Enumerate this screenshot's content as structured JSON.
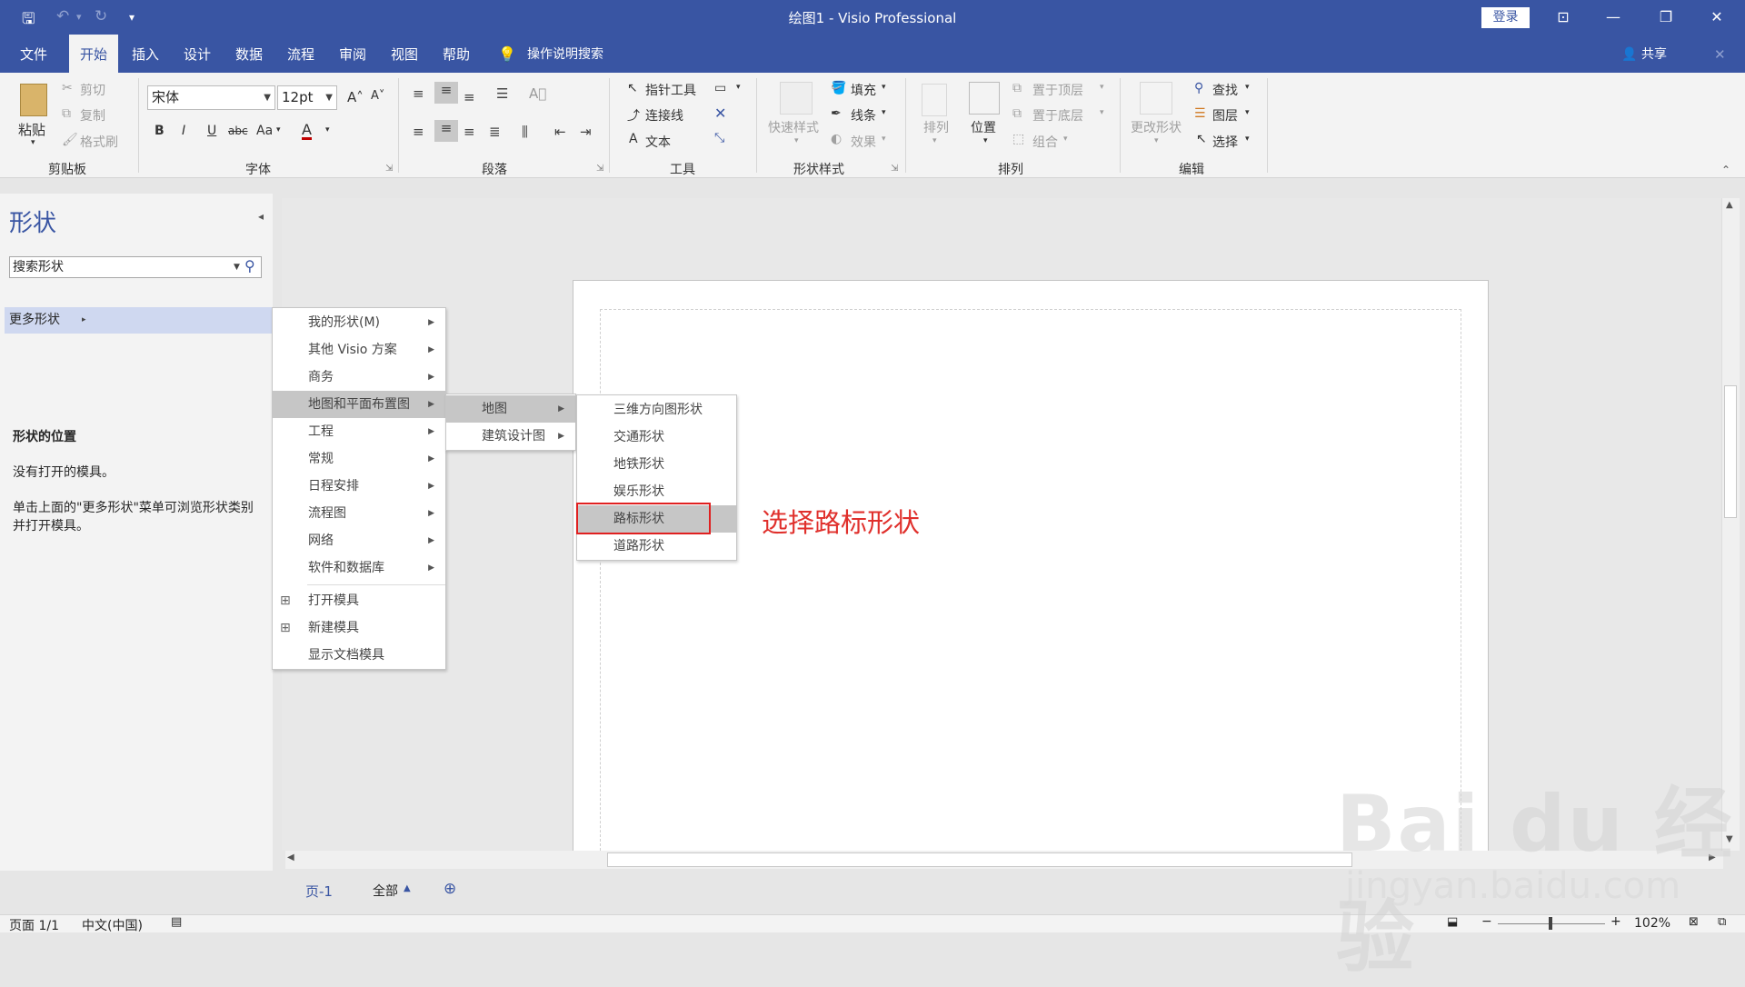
{
  "titlebar": {
    "title": "绘图1  -  Visio Professional",
    "login": "登录",
    "icons": [
      "save-icon",
      "undo-icon",
      "redo-icon",
      "customize-icon",
      "ribbon-display-icon",
      "minimize-icon",
      "restore-icon",
      "close-icon"
    ]
  },
  "tabs": {
    "items": [
      "文件",
      "开始",
      "插入",
      "设计",
      "数据",
      "流程",
      "审阅",
      "视图",
      "帮助"
    ],
    "active": "开始",
    "tell_me": "操作说明搜索",
    "share": "共享"
  },
  "ribbon": {
    "clipboard": {
      "label": "剪贴板",
      "paste": "粘贴",
      "cut": "剪切",
      "copy": "复制",
      "format_painter": "格式刷"
    },
    "font": {
      "label": "字体",
      "font_name": "宋体",
      "font_size": "12pt",
      "bold": "B",
      "italic": "I",
      "underline": "U",
      "strike": "abc",
      "case": "Aa",
      "color": "A"
    },
    "paragraph": {
      "label": "段落"
    },
    "tools": {
      "label": "工具",
      "pointer": "指针工具",
      "connector": "连接线",
      "text": "文本"
    },
    "shape_styles": {
      "label": "形状样式",
      "quick_styles": "快速样式",
      "fill": "填充",
      "line": "线条",
      "effects": "效果"
    },
    "arrange": {
      "label": "排列",
      "arrange_btn": "排列",
      "position": "位置",
      "bring_front": "置于顶层",
      "send_back": "置于底层",
      "group": "组合"
    },
    "editing": {
      "label": "编辑",
      "change_shape": "更改形状",
      "find": "查找",
      "layers": "图层",
      "select": "选择"
    }
  },
  "shapes_pane": {
    "title": "形状",
    "search_placeholder": "搜索形状",
    "more_shapes": "更多形状",
    "location_title": "形状的位置",
    "no_stencil": "没有打开的模具。",
    "hint": "单击上面的\"更多形状\"菜单可浏览形状类别并打开模具。"
  },
  "menu1": {
    "items": [
      {
        "label": "我的形状(M)",
        "submenu": true
      },
      {
        "label": "其他 Visio 方案",
        "submenu": true
      },
      {
        "label": "商务",
        "submenu": true
      },
      {
        "label": "地图和平面布置图",
        "submenu": true,
        "highlighted": true
      },
      {
        "label": "工程",
        "submenu": true
      },
      {
        "label": "常规",
        "submenu": true
      },
      {
        "label": "日程安排",
        "submenu": true
      },
      {
        "label": "流程图",
        "submenu": true
      },
      {
        "label": "网络",
        "submenu": true
      },
      {
        "label": "软件和数据库",
        "submenu": true
      },
      {
        "label": "打开模具",
        "submenu": false
      },
      {
        "label": "新建模具",
        "submenu": false
      },
      {
        "label": "显示文档模具",
        "submenu": false
      }
    ]
  },
  "menu2": {
    "items": [
      {
        "label": "地图",
        "highlighted": true
      },
      {
        "label": "建筑设计图",
        "highlighted": false
      }
    ]
  },
  "menu3": {
    "items": [
      "三维方向图形状",
      "交通形状",
      "地铁形状",
      "娱乐形状",
      "路标形状",
      "道路形状"
    ],
    "selected": "路标形状"
  },
  "annotation": "选择路标形状",
  "sheets": {
    "page": "页-1",
    "all": "全部"
  },
  "status": {
    "page": "页面 1/1",
    "language": "中文(中国)",
    "zoom": "102%"
  },
  "watermark": {
    "brand": "Bai du 经验",
    "url": "jingyan.baidu.com"
  },
  "colors": {
    "titlebar": "#3955a3",
    "ribbon": "#f3f3f3",
    "accent": "#3955a3",
    "annotation": "#e0302c"
  }
}
